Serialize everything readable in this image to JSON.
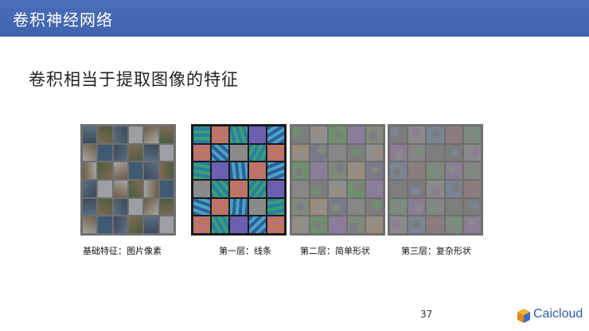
{
  "header": {
    "title": "卷积神经网络"
  },
  "slide": {
    "subtitle": "卷积相当于提取图像的特征"
  },
  "panels": [
    {
      "caption": "基础特征：图片像素",
      "palette": [
        "#3b4a5a",
        "#7d6a55",
        "#5a6f7f",
        "#9aa0a5",
        "#6d5a47",
        "#4c5c3d",
        "#a5a6a0",
        "#3f5a72"
      ]
    },
    {
      "caption": "第一层：线条",
      "palette": [
        "#2a7da8",
        "#c07a48",
        "#3aa070",
        "#6a5fb0",
        "#2e5f9a",
        "#b86e8a",
        "#4aa3c4",
        "#8a8a8a"
      ]
    },
    {
      "caption": "第二层：简单形状",
      "palette": [
        "#7d7d7d",
        "#8e8e8e",
        "#6f8f6f",
        "#8a7d9a",
        "#7f8a7a",
        "#9a8b7a",
        "#7a7a8a",
        "#868686"
      ]
    },
    {
      "caption": "第三层：复杂形状",
      "palette": [
        "#7c7c7c",
        "#8a8a8a",
        "#7a8494",
        "#8c7c7c",
        "#7a8c7c",
        "#8a7c94",
        "#858585",
        "#7e7e7e"
      ]
    }
  ],
  "footer": {
    "page_number": "37",
    "logo_text": "Caicloud"
  }
}
